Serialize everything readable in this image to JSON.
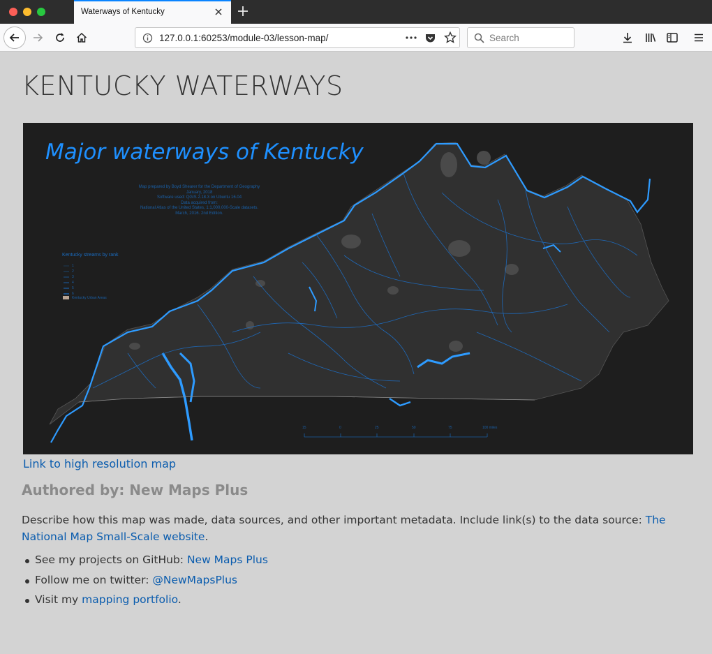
{
  "browser": {
    "tab_title": "Waterways of Kentucky",
    "url": "127.0.0.1:60253/module-03/lesson-map/",
    "search_placeholder": "Search"
  },
  "page": {
    "title": "KENTUCKY WATERWAYS",
    "map": {
      "title": "Major waterways of Kentucky",
      "credits": [
        "Map prepared by Boyd Shearer for the Department of Geography",
        "January, 2018",
        "Software used: QGIS 2.18.3 on Ubuntu 16.04",
        "Data acquired from:",
        "National Atlas of the United States, 1:1,000,000-Scale datasets.",
        "March, 2016. 2nd Edition."
      ],
      "legend_title": "Kentucky streams by rank",
      "legend_items": [
        "1",
        "2",
        "3",
        "4",
        "5",
        "6",
        "7",
        "Kentucky Urban Areas"
      ],
      "scale_labels": [
        "15",
        "0",
        "25",
        "50",
        "75",
        "100 miles"
      ],
      "colors": {
        "water": "#2e9bff",
        "land": "#303030",
        "urban": "#4a4a4a",
        "background": "#1e1e1e"
      }
    },
    "map_link": "Link to high resolution map",
    "author": "Authored by: New Maps Plus",
    "description": {
      "text": "Describe how this map was made, data sources, and other important metadata. Include link(s) to the data source: ",
      "link": "The National Map Small-Scale website",
      "end": "."
    },
    "bullets": [
      {
        "text": "See my projects on GitHub: ",
        "link": "New Maps Plus",
        "end": ""
      },
      {
        "text": "Follow me on twitter: ",
        "link": "@NewMapsPlus",
        "end": ""
      },
      {
        "text": "Visit my ",
        "link": "mapping portfolio",
        "end": "."
      }
    ]
  }
}
